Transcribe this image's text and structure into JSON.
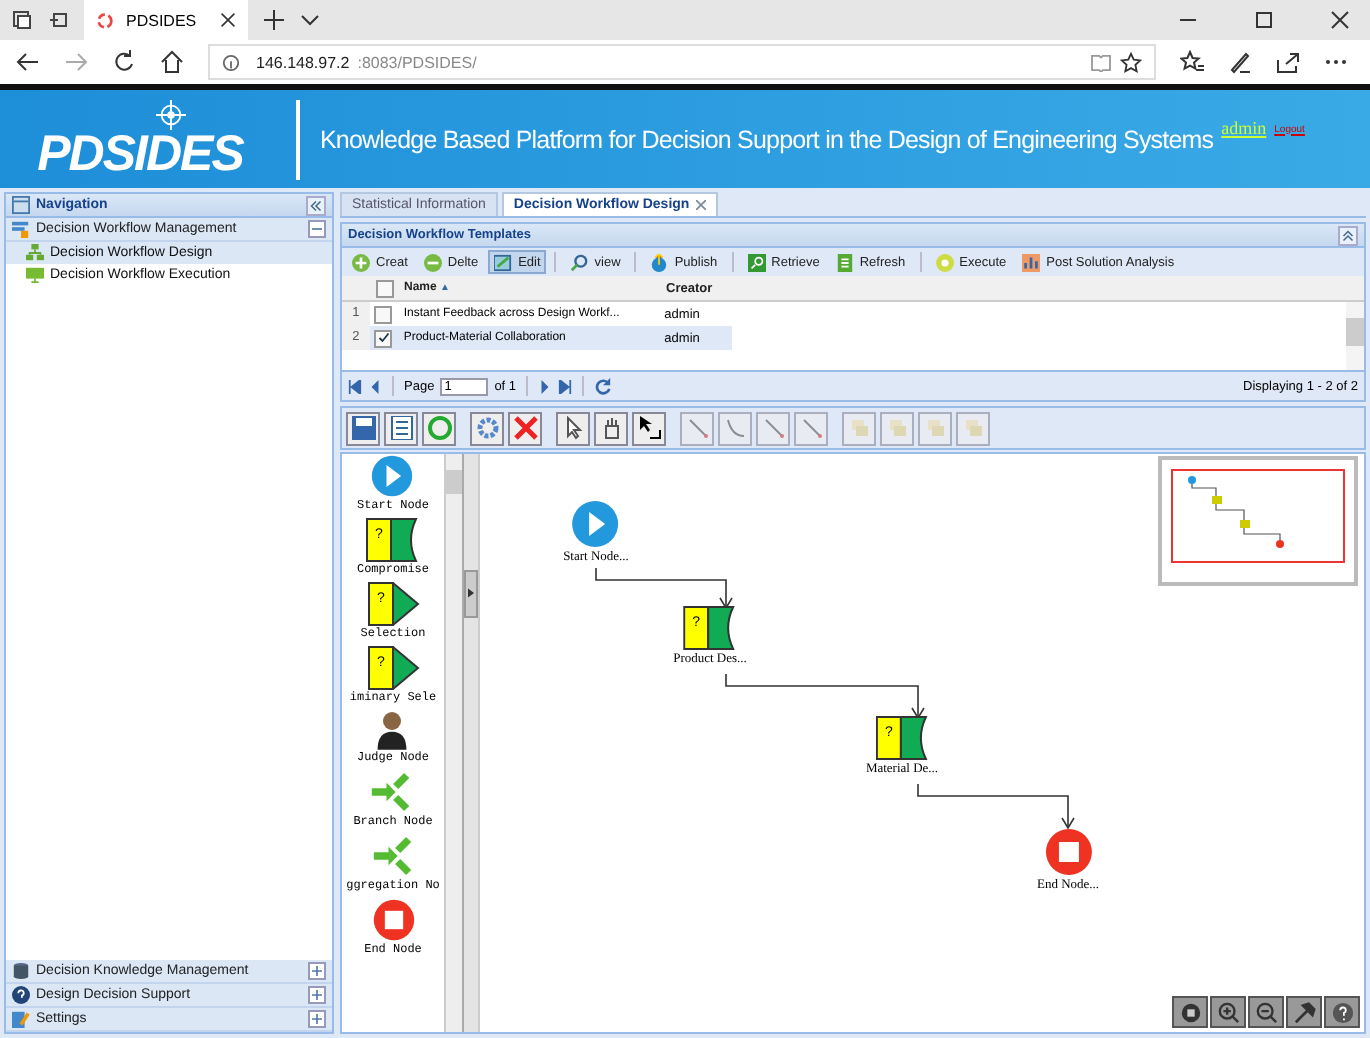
{
  "browser": {
    "tab_title": "PDSIDES",
    "url_host": "146.148.97.2",
    "url_path": ":8083/PDSIDES/"
  },
  "header": {
    "logo": "PDSIDES",
    "title": "Knowledge Based Platform for Decision Support in the Design of Engineering Systems",
    "user": "admin",
    "logout": "Logout"
  },
  "navigation": {
    "title": "Navigation",
    "groups": [
      {
        "label": "Decision Workflow Management",
        "expanded": true,
        "children": [
          {
            "label": "Decision Workflow Design",
            "selected": true
          },
          {
            "label": "Decision Workflow Execution",
            "selected": false
          }
        ]
      }
    ],
    "bottom_groups": [
      {
        "label": "Decision Knowledge Management",
        "expanded": false
      },
      {
        "label": "Design Decision Support",
        "expanded": false
      },
      {
        "label": "Settings",
        "expanded": false
      }
    ]
  },
  "tabs": [
    {
      "label": "Statistical Information",
      "selected": false,
      "closable": false
    },
    {
      "label": "Decision Workflow Design",
      "selected": true,
      "closable": true
    }
  ],
  "templates": {
    "title": "Decision Workflow Templates",
    "toolbar": [
      {
        "label": "Creat",
        "pressed": false
      },
      {
        "label": "Delte",
        "pressed": false
      },
      {
        "label": "Edit",
        "pressed": true
      },
      {
        "label": "view",
        "pressed": false
      },
      {
        "label": "Publish",
        "pressed": false
      },
      {
        "label": "Retrieve",
        "pressed": false
      },
      {
        "label": "Refresh",
        "pressed": false
      },
      {
        "label": "Execute",
        "pressed": false
      },
      {
        "label": "Post Solution Analysis",
        "pressed": false
      }
    ],
    "select_all_checked": false,
    "columns": [
      {
        "label": "Name",
        "sort": "▲"
      },
      {
        "label": "Creator"
      }
    ],
    "rows": [
      {
        "number": "1",
        "name": "Instant Feedback across Design Workf...",
        "creator": "admin",
        "checked": false,
        "selected": false
      },
      {
        "number": "2",
        "name": "Product-Material Collaboration",
        "creator": "admin",
        "checked": true,
        "selected": true
      }
    ],
    "pager": {
      "page_label": "Page",
      "page": "1",
      "of": "of 1",
      "display": "Displaying 1 - 2 of 2"
    }
  },
  "palette": [
    {
      "kind": "start",
      "label": "Start Node"
    },
    {
      "kind": "compromise",
      "label": "Compromise",
      "symbol": "?"
    },
    {
      "kind": "selection",
      "label": "Selection",
      "symbol": "?"
    },
    {
      "kind": "selection",
      "label": "iminary Sele",
      "symbol": "?"
    },
    {
      "kind": "judge",
      "label": "Judge Node"
    },
    {
      "kind": "branch",
      "label": "Branch Node"
    },
    {
      "kind": "aggregation",
      "label": "ggregation No"
    },
    {
      "kind": "end",
      "label": "End Node"
    }
  ],
  "canvas": {
    "nodes": [
      {
        "kind": "start",
        "label": "Start Node..."
      },
      {
        "kind": "compromise",
        "label": "Product Des...",
        "symbol": "?"
      },
      {
        "kind": "compromise",
        "label": "Material De...",
        "symbol": "?"
      },
      {
        "kind": "end",
        "label": "End Node..."
      }
    ]
  }
}
